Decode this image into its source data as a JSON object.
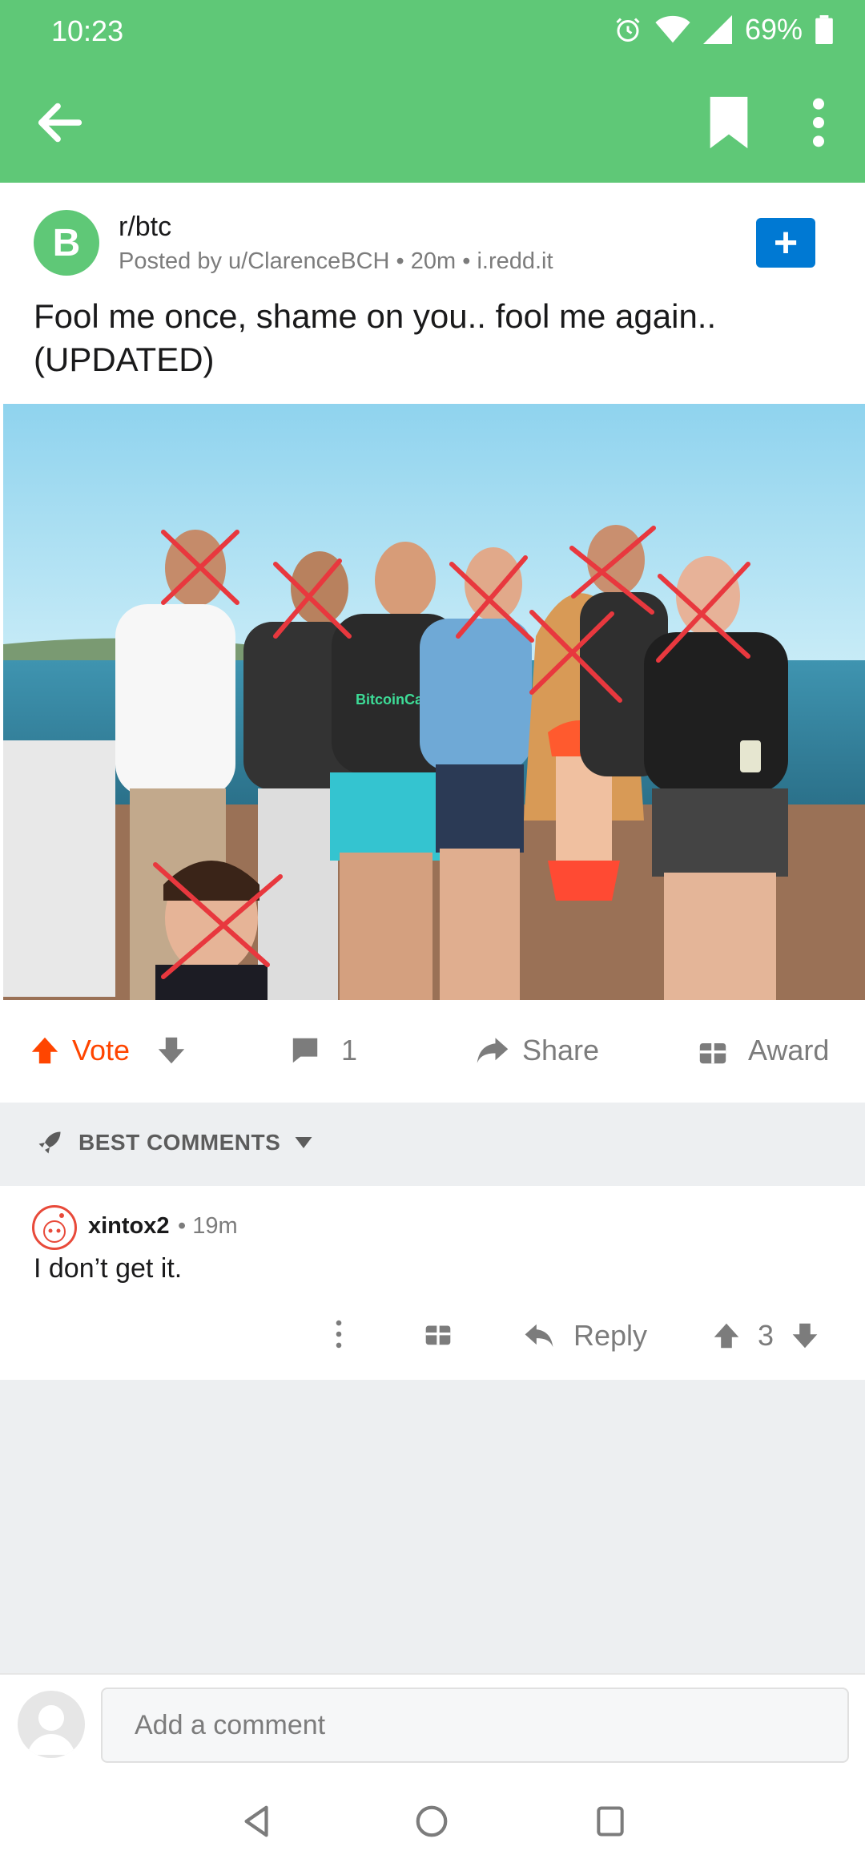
{
  "status": {
    "time": "10:23",
    "battery": "69%"
  },
  "appbar": {
    "back_icon": "arrow-left-icon",
    "bookmark_icon": "bookmark-icon",
    "more_icon": "more-vertical-icon"
  },
  "post": {
    "subreddit": "r/btc",
    "subreddit_icon_glyph": "B",
    "meta": "Posted by u/ClarenceBCH • 20m • i.redd.it",
    "join_label": "+",
    "title": "Fool me once, shame on you.. fool me again.. (UPDATED)",
    "image_shirt_text": "BitcoinCash"
  },
  "actions": {
    "vote_label": "Vote",
    "comment_count": "1",
    "share_label": "Share",
    "award_label": "Award"
  },
  "sort": {
    "label": "BEST COMMENTS"
  },
  "comment": {
    "author": "xintox2",
    "time": "• 19m",
    "body": "I don’t get it.",
    "reply_label": "Reply",
    "score": "3"
  },
  "composer": {
    "placeholder": "Add a comment"
  },
  "colors": {
    "brand": "#5fc877",
    "vote_accent": "#ff4500",
    "join_button": "#0079d3"
  }
}
